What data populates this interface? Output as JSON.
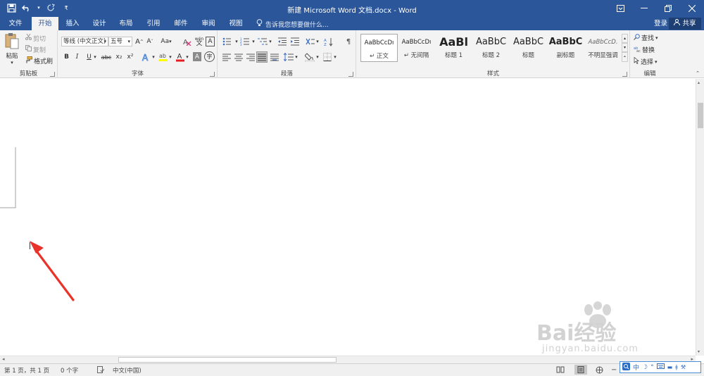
{
  "window": {
    "title": "新建 Microsoft Word 文档.docx - Word"
  },
  "tabs": [
    {
      "label": "文件"
    },
    {
      "label": "开始"
    },
    {
      "label": "插入"
    },
    {
      "label": "设计"
    },
    {
      "label": "布局"
    },
    {
      "label": "引用"
    },
    {
      "label": "邮件"
    },
    {
      "label": "审阅"
    },
    {
      "label": "视图"
    }
  ],
  "tell_me": "告诉我您想要做什么...",
  "account": {
    "login": "登录",
    "share": "共享"
  },
  "clipboard": {
    "paste": "粘贴",
    "cut": "剪切",
    "copy": "复制",
    "format_painter": "格式刷",
    "label": "剪贴板"
  },
  "font": {
    "name": "等线 (中文正文)",
    "size": "五号",
    "case": "Aa",
    "label": "字体",
    "bold": "B",
    "italic": "I",
    "underline": "U",
    "strike": "abc",
    "subscript": "x₂",
    "superscript": "x²",
    "wen": "wén",
    "a_border": "A"
  },
  "paragraph": {
    "label": "段落"
  },
  "styles": {
    "label": "样式",
    "items": [
      {
        "preview": "AaBbCcDı",
        "name": "↵ 正文"
      },
      {
        "preview": "AaBbCcDı",
        "name": "↵ 无间隔"
      },
      {
        "preview": "AaBl",
        "name": "标题 1"
      },
      {
        "preview": "AaBbC",
        "name": "标题 2"
      },
      {
        "preview": "AaBbC",
        "name": "标题"
      },
      {
        "preview": "AaBbC",
        "name": "副标题"
      },
      {
        "preview": "AaBbCcD.",
        "name": "不明显强调"
      }
    ]
  },
  "editing": {
    "find": "查找",
    "replace": "替换",
    "select": "选择",
    "label": "编辑"
  },
  "status": {
    "page": "第 1 页，共 1 页",
    "words": "0 个字",
    "language": "中文(中国)"
  },
  "ime": {
    "lang": "中"
  },
  "watermark": {
    "line1": "Bai经验",
    "line2": "jingyan.baidu.com"
  },
  "colors": {
    "accent": "#2b579a",
    "ribbon": "#f3f3f3",
    "arrow": "#e8322a"
  }
}
